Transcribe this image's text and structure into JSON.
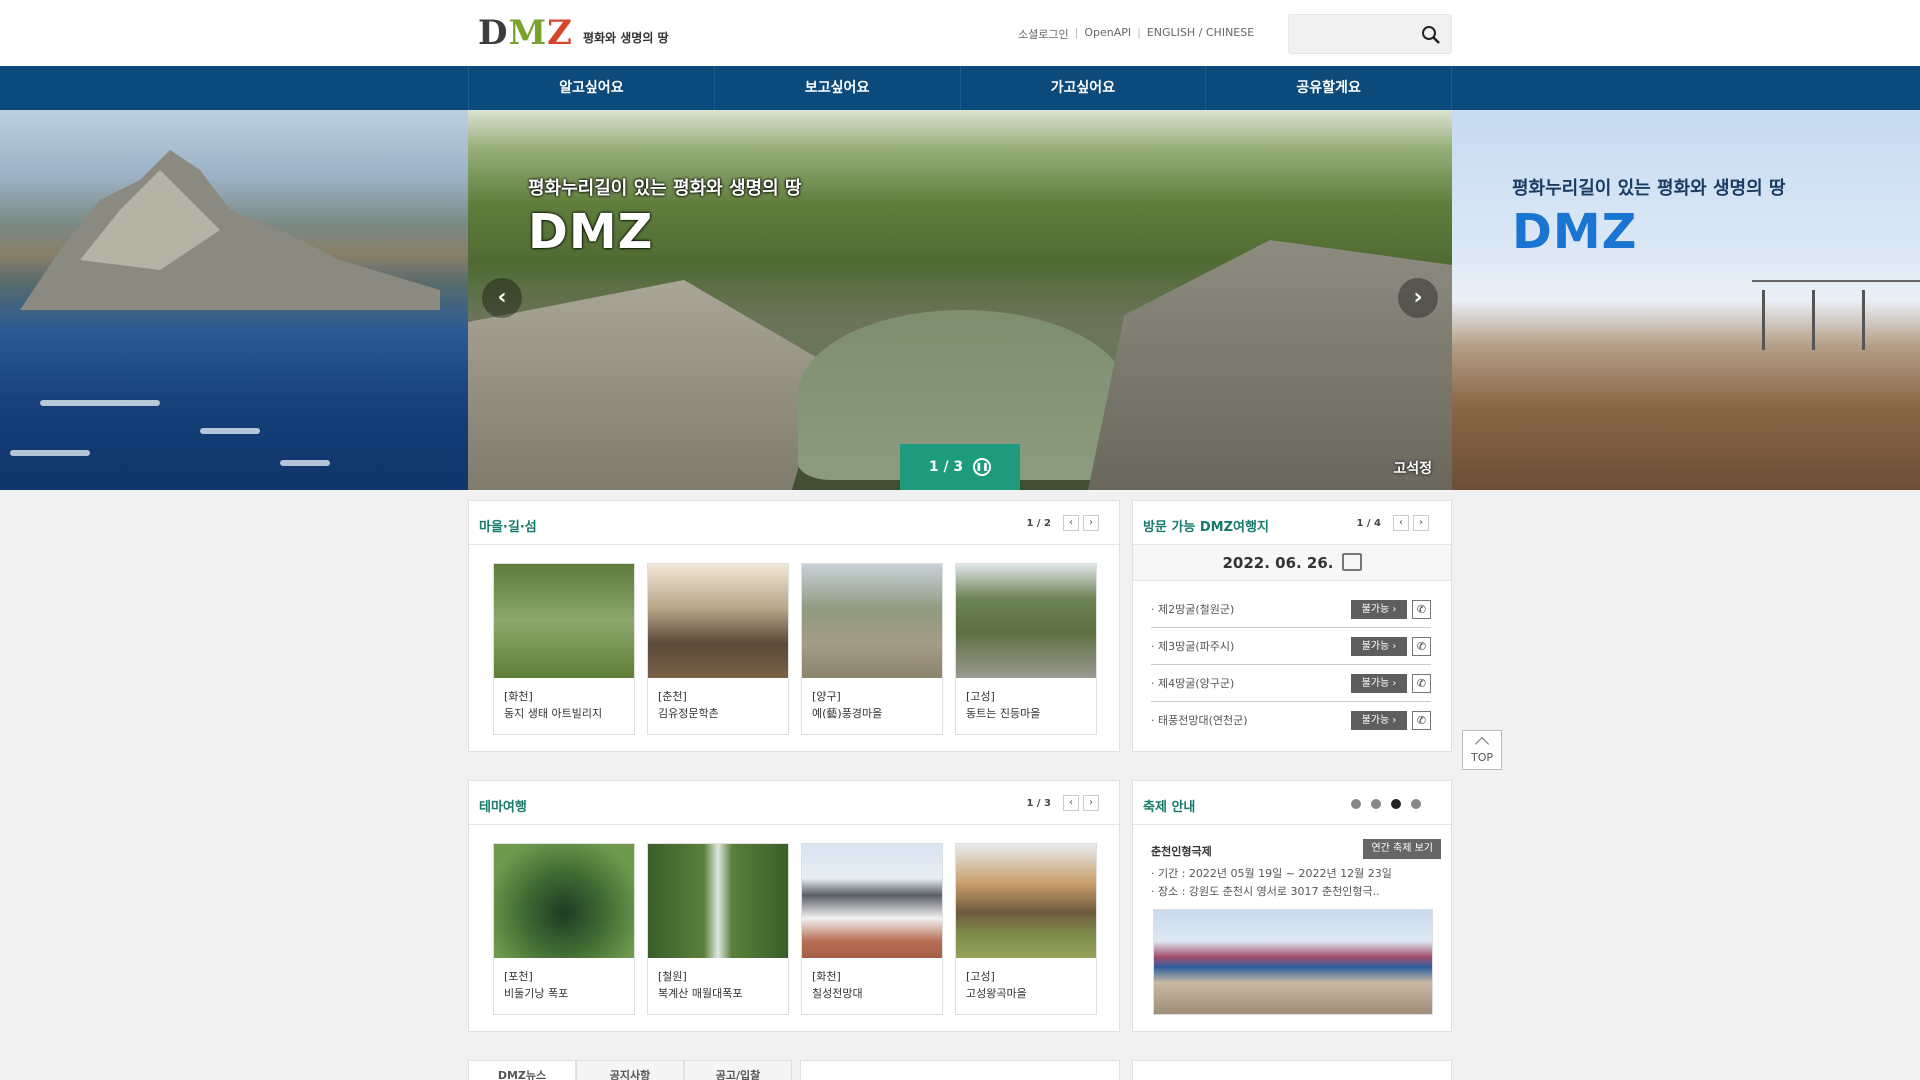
{
  "header": {
    "logo_text": "DMZ",
    "logo_subtitle": "평화와 생명의 땅",
    "util_links": [
      "소셜로그인",
      "OpenAPI",
      "ENGLISH / CHINESE"
    ],
    "search_placeholder": ""
  },
  "nav": {
    "items": [
      "알고싶어요",
      "보고싶어요",
      "가고싶어요",
      "공유할게요"
    ]
  },
  "hero": {
    "caption_small": "평화누리길이 있는 평화와 생명의 땅",
    "caption_big": "DMZ",
    "pager": "1 / 3",
    "spot_label": "고석정",
    "right_caption_small": "평화누리길이 있는 평화와 생명의 땅",
    "right_caption_big": "DMZ"
  },
  "village": {
    "title": "마을·길·섬",
    "count": "1 / 2",
    "cards": [
      {
        "region": "[화천]",
        "name": "동지 생태 아트빌리지"
      },
      {
        "region": "[춘천]",
        "name": "김유정문학촌"
      },
      {
        "region": "[양구]",
        "name": "예(藝)풍경마을"
      },
      {
        "region": "[고성]",
        "name": "동트는 진등마을"
      }
    ]
  },
  "visit": {
    "title": "방문 가능 DMZ여행지",
    "count": "1 / 4",
    "date": "2022. 06. 26.",
    "rows": [
      {
        "name": "제2땅굴(철원군)",
        "status": "불가능 ›"
      },
      {
        "name": "제3땅굴(파주시)",
        "status": "불가능 ›"
      },
      {
        "name": "제4땅굴(양구군)",
        "status": "불가능 ›"
      },
      {
        "name": "태풍전망대(연천군)",
        "status": "불가능 ›"
      }
    ]
  },
  "theme": {
    "title": "테마여행",
    "count": "1 / 3",
    "cards": [
      {
        "region": "[포천]",
        "name": "비둘기낭 폭포"
      },
      {
        "region": "[철원]",
        "name": "복계산 매월대폭포"
      },
      {
        "region": "[화천]",
        "name": "칠성전망대"
      },
      {
        "region": "[고성]",
        "name": "고성왕곡마을"
      }
    ]
  },
  "festival": {
    "title": "축제 안내",
    "name": "춘천인형극제",
    "btn": "연간 축제 보기",
    "period": "· 기간 : 2022년 05월 19일 ~ 2022년 12월 23일",
    "place": "· 장소 : 강원도 춘천시 영서로 3017 춘천인형극.."
  },
  "top_label": "TOP",
  "bottom_tabs": [
    "DMZ뉴스",
    "공지사항",
    "공고/입찰"
  ],
  "colors": {
    "nav": "#0b4a7a",
    "accent": "#15796b",
    "pager": "#1e9a7c"
  }
}
